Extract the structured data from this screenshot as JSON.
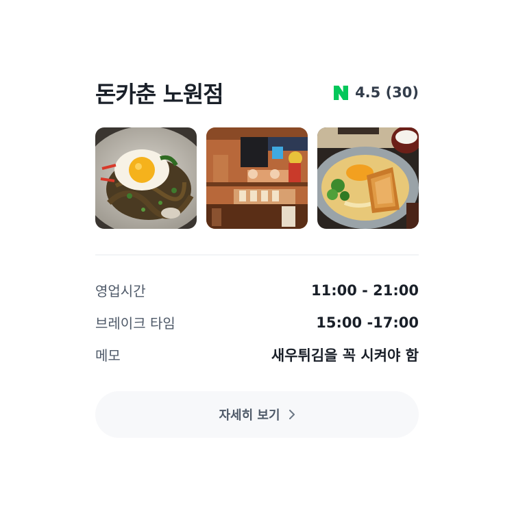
{
  "restaurant": {
    "name": "돈카춘 노원점",
    "rating_text": "4.5 (30)",
    "rating": 4.5,
    "review_count": 30,
    "source_icon": "naver-n-icon",
    "brand_color": "#03c75a"
  },
  "photos": [
    {
      "alt": "야끼소바 계란후라이"
    },
    {
      "alt": "가게 내부"
    },
    {
      "alt": "카츠동"
    }
  ],
  "info": [
    {
      "label": "영업시간",
      "value": "11:00 - 21:00"
    },
    {
      "label": "브레이크 타임",
      "value": "15:00 -17:00"
    },
    {
      "label": "메모",
      "value": "새우튀김을 꼭 시켜야 함"
    }
  ],
  "detail_button": {
    "label": "자세히 보기",
    "icon": "chevron-right-icon"
  }
}
